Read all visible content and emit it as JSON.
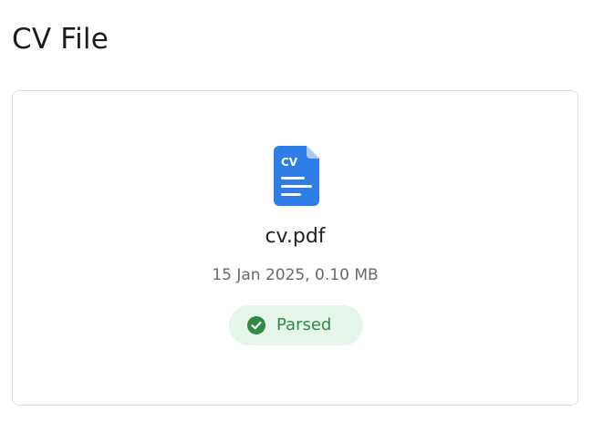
{
  "page": {
    "title": "CV File"
  },
  "file": {
    "icon_name": "cv-document-icon",
    "icon_text": "CV",
    "name": "cv.pdf",
    "meta": "15 Jan 2025, 0.10 MB",
    "status": "Parsed",
    "status_icon": "check-circle-icon"
  },
  "colors": {
    "icon_blue": "#2f7de6",
    "status_bg": "#e6f5ea",
    "status_green": "#2e8a45"
  }
}
